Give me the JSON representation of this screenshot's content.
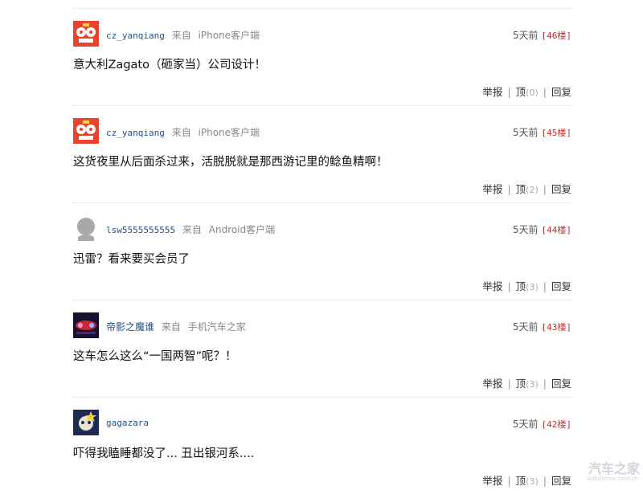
{
  "comments": [
    {
      "username": "cz_yanqiang",
      "from_label": "来自",
      "device": "iPhone客户端",
      "time": "5天前",
      "floor": "[46楼]",
      "text": "意大利Zagato（砸家当）公司设计！",
      "report": "举报",
      "like": "顶",
      "like_count": "(0)",
      "reply": "回复",
      "avatar_icon": "cartoon-avatar-icon"
    },
    {
      "username": "cz_yanqiang",
      "from_label": "来自",
      "device": "iPhone客户端",
      "time": "5天前",
      "floor": "[45楼]",
      "text": "这货夜里从后面杀过来，活脱脱就是那西游记里的鲶鱼精啊！",
      "report": "举报",
      "like": "顶",
      "like_count": "(2)",
      "reply": "回复",
      "avatar_icon": "cartoon-avatar-icon"
    },
    {
      "username": "lsw5555555555",
      "from_label": "来自",
      "device": "Android客户端",
      "time": "5天前",
      "floor": "[44楼]",
      "text": "迅雷？看来要买会员了",
      "report": "举报",
      "like": "顶",
      "like_count": "(3)",
      "reply": "回复",
      "avatar_icon": "default-user-avatar-icon"
    },
    {
      "username": "帝影之魔谁",
      "from_label": "来自",
      "device": "手机汽车之家",
      "time": "5天前",
      "floor": "[43楼]",
      "text": "这车怎么这么“一国两智”呢？！",
      "report": "举报",
      "like": "顶",
      "like_count": "(3)",
      "reply": "回复",
      "avatar_icon": "photo-avatar-icon"
    },
    {
      "username": "gagazara",
      "from_label": "",
      "device": "",
      "time": "5天前",
      "floor": "[42楼]",
      "text": "吓得我瞌睡都没了... 丑出银河系....",
      "report": "举报",
      "like": "顶",
      "like_count": "(3)",
      "reply": "回复",
      "avatar_icon": "anime-avatar-icon"
    }
  ],
  "watermark": {
    "main": "汽车之家",
    "sub": "Autohome.com.cn"
  },
  "colors": {
    "username": "#1f4f8a",
    "floor": "#c03030",
    "meta": "#888888",
    "divider": "#d6d6d6"
  }
}
